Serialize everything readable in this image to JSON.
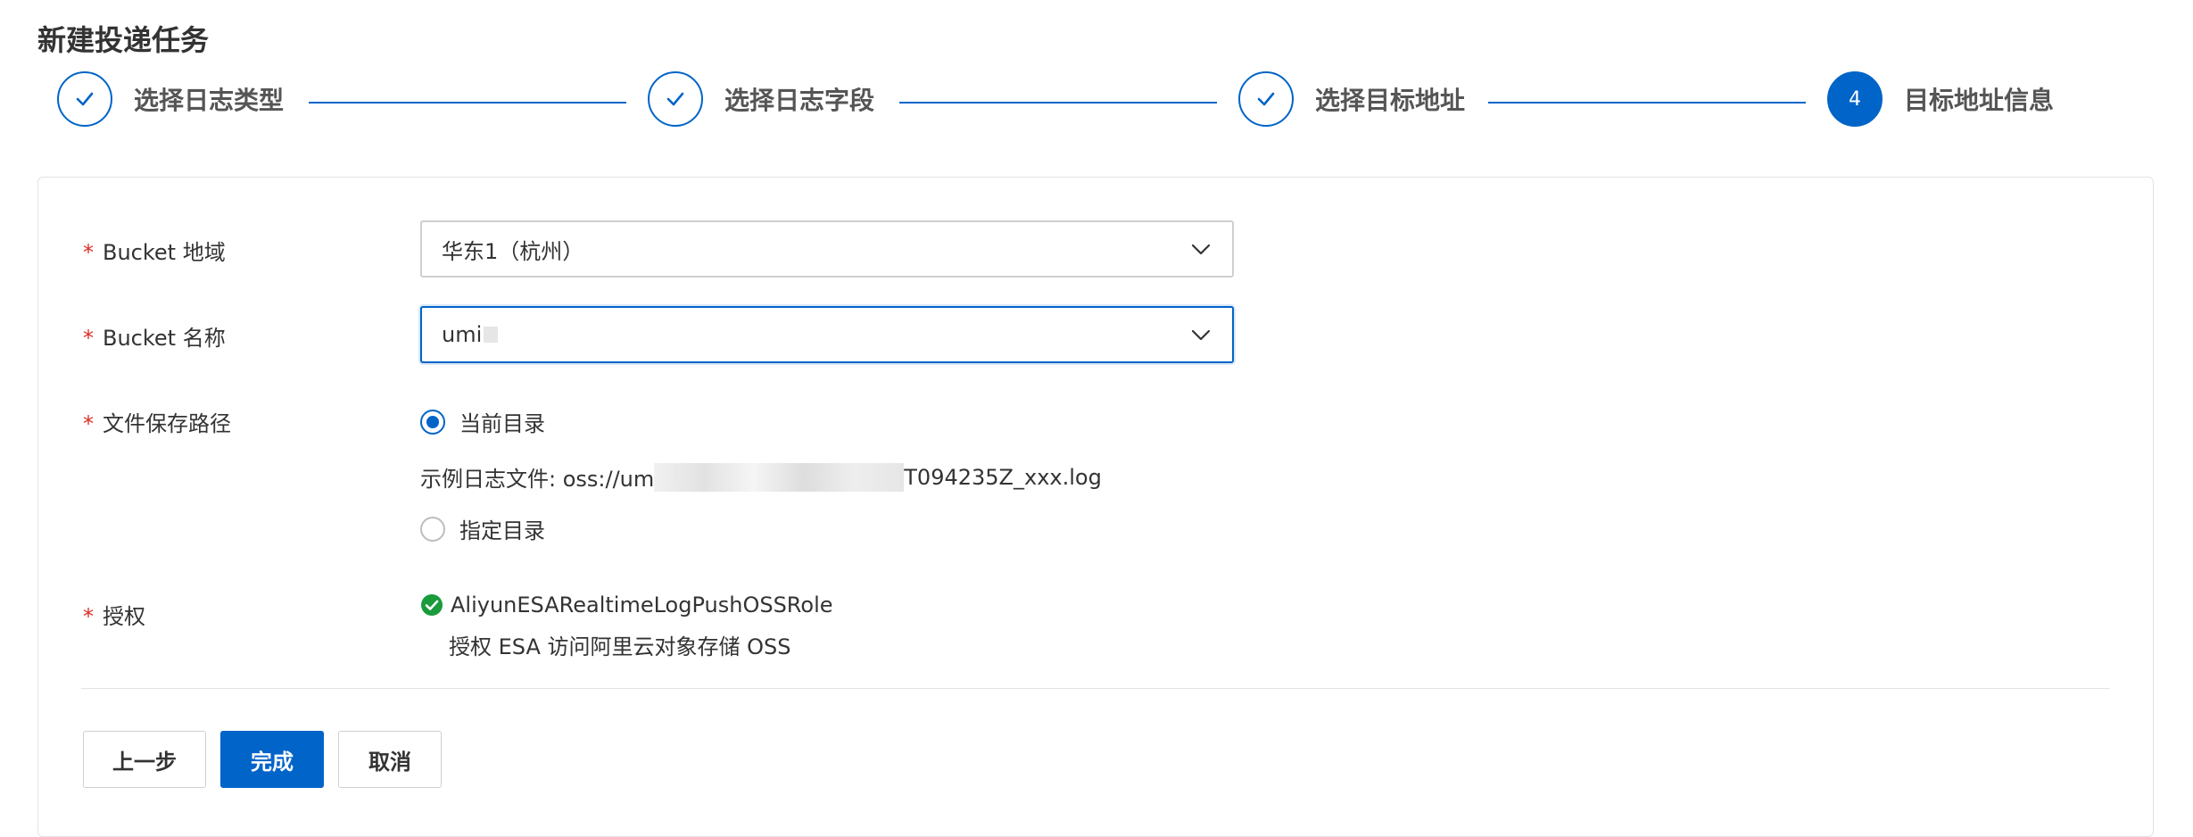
{
  "page": {
    "title": "新建投递任务"
  },
  "steps": [
    {
      "label": "选择日志类型",
      "state": "done",
      "icon": "check-icon"
    },
    {
      "label": "选择日志字段",
      "state": "done",
      "icon": "check-icon"
    },
    {
      "label": "选择目标地址",
      "state": "done",
      "icon": "check-icon"
    },
    {
      "label": "目标地址信息",
      "state": "active",
      "number": "4"
    }
  ],
  "form": {
    "required_mark": "*",
    "bucket_region": {
      "label": "Bucket 地域",
      "value": "华东1（杭州）",
      "icon": "chevron-down-icon"
    },
    "bucket_name": {
      "label": "Bucket 名称",
      "value": "umi",
      "icon": "chevron-down-icon"
    },
    "save_path": {
      "label": "文件保存路径",
      "options": [
        {
          "label": "当前目录",
          "checked": true
        },
        {
          "label": "指定目录",
          "checked": false
        }
      ],
      "example_prefix": "示例日志文件: oss://um",
      "example_suffix": "T094235Z_xxx.log"
    },
    "authorization": {
      "label": "授权",
      "role": "AliyunESARealtimeLogPushOSSRole",
      "description": "授权 ESA 访问阿里云对象存储 OSS",
      "icon": "check-circle-icon"
    }
  },
  "buttons": {
    "prev": "上一步",
    "finish": "完成",
    "cancel": "取消"
  },
  "colors": {
    "primary": "#0064c8",
    "required": "#d93026",
    "success": "#1a9b3c"
  }
}
